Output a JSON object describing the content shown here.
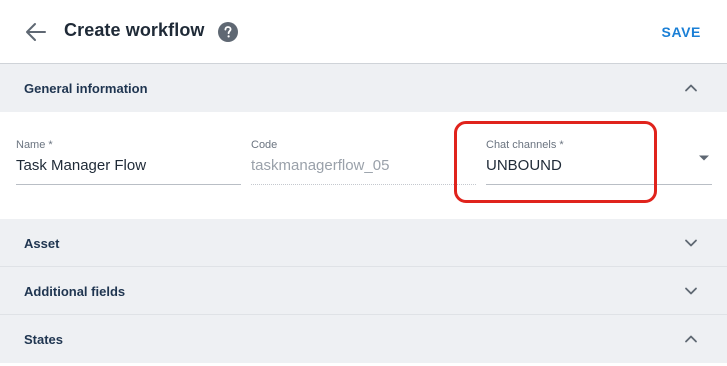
{
  "header": {
    "title": "Create workflow",
    "save_label": "SAVE",
    "back_icon": "arrow-left-icon",
    "help_icon": "help-circle-icon"
  },
  "sections": {
    "general": {
      "label": "General information",
      "expanded": true
    },
    "asset": {
      "label": "Asset",
      "expanded": false
    },
    "additional": {
      "label": "Additional fields",
      "expanded": false
    },
    "states": {
      "label": "States",
      "expanded": true
    }
  },
  "form": {
    "name": {
      "label": "Name *",
      "value": "Task Manager Flow"
    },
    "code": {
      "label": "Code",
      "value": "taskmanagerflow_05"
    },
    "chat_channels": {
      "label": "Chat channels *",
      "value": "UNBOUND"
    }
  },
  "colors": {
    "accent": "#1a7fd6",
    "highlight": "#e0231c",
    "section_bg": "#eef0f3"
  }
}
